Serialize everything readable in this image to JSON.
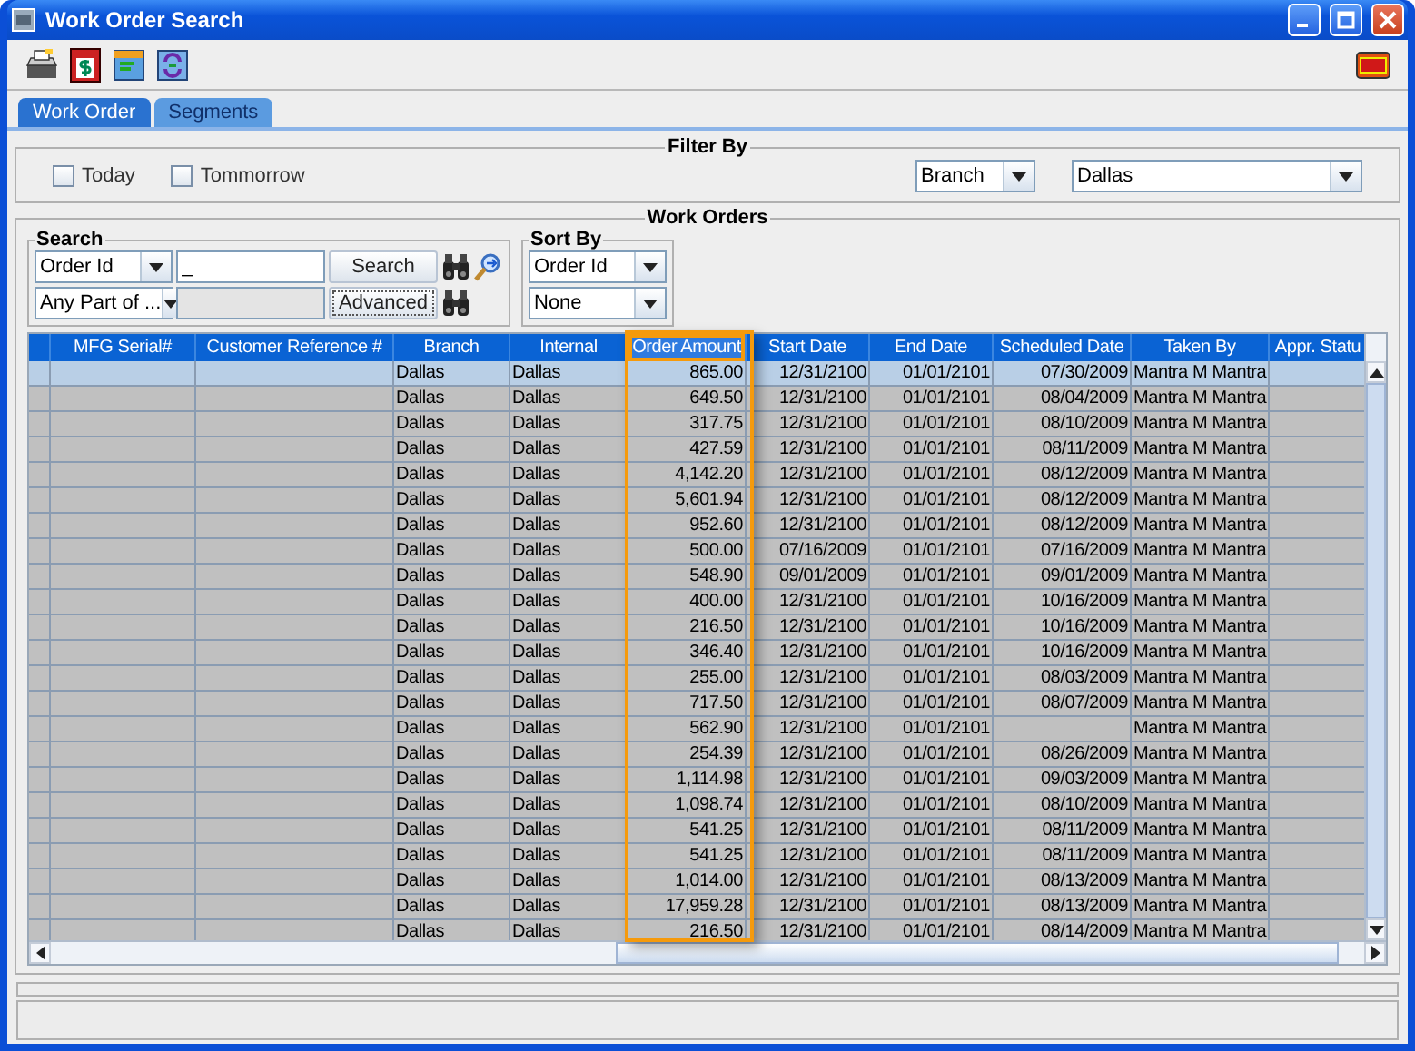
{
  "window": {
    "title": "Work Order Search"
  },
  "tabs": [
    {
      "label": "Work Order",
      "selected": true
    },
    {
      "label": "Segments",
      "selected": false
    }
  ],
  "filter": {
    "title": "Filter By",
    "today": {
      "label": "Today",
      "checked": false
    },
    "tomorrow": {
      "label": "Tommorrow",
      "checked": false
    },
    "field": "Branch",
    "value": "Dallas"
  },
  "work_orders": {
    "title": "Work Orders",
    "search": {
      "title": "Search",
      "field": "Order Id",
      "match": "Any Part of ...",
      "value": "_",
      "search_button": "Search",
      "advanced_button": "Advanced"
    },
    "sort": {
      "title": "Sort By",
      "field": "Order Id",
      "order": "None"
    },
    "table": {
      "columns": [
        {
          "label": "MFG Serial#",
          "highlighted": false
        },
        {
          "label": "Customer Reference #",
          "highlighted": false
        },
        {
          "label": "Branch",
          "highlighted": false
        },
        {
          "label": "Internal",
          "highlighted": false
        },
        {
          "label": "Order Amount",
          "highlighted": true
        },
        {
          "label": "Start Date",
          "highlighted": false
        },
        {
          "label": "End Date",
          "highlighted": false
        },
        {
          "label": "Scheduled Date",
          "highlighted": false
        },
        {
          "label": "Taken By",
          "highlighted": false
        },
        {
          "label": "Appr. Statu",
          "highlighted": false
        }
      ],
      "rows": [
        {
          "selected": true,
          "branch": "Dallas",
          "internal": "Dallas",
          "order_amount": "865.00",
          "start_date": "12/31/2100",
          "end_date": "01/01/2101",
          "scheduled_date": "07/30/2009",
          "taken_by": "Mantra M Mantra"
        },
        {
          "selected": false,
          "branch": "Dallas",
          "internal": "Dallas",
          "order_amount": "649.50",
          "start_date": "12/31/2100",
          "end_date": "01/01/2101",
          "scheduled_date": "08/04/2009",
          "taken_by": "Mantra M Mantra"
        },
        {
          "selected": false,
          "branch": "Dallas",
          "internal": "Dallas",
          "order_amount": "317.75",
          "start_date": "12/31/2100",
          "end_date": "01/01/2101",
          "scheduled_date": "08/10/2009",
          "taken_by": "Mantra M Mantra"
        },
        {
          "selected": false,
          "branch": "Dallas",
          "internal": "Dallas",
          "order_amount": "427.59",
          "start_date": "12/31/2100",
          "end_date": "01/01/2101",
          "scheduled_date": "08/11/2009",
          "taken_by": "Mantra M Mantra"
        },
        {
          "selected": false,
          "branch": "Dallas",
          "internal": "Dallas",
          "order_amount": "4,142.20",
          "start_date": "12/31/2100",
          "end_date": "01/01/2101",
          "scheduled_date": "08/12/2009",
          "taken_by": "Mantra M Mantra"
        },
        {
          "selected": false,
          "branch": "Dallas",
          "internal": "Dallas",
          "order_amount": "5,601.94",
          "start_date": "12/31/2100",
          "end_date": "01/01/2101",
          "scheduled_date": "08/12/2009",
          "taken_by": "Mantra M Mantra"
        },
        {
          "selected": false,
          "branch": "Dallas",
          "internal": "Dallas",
          "order_amount": "952.60",
          "start_date": "12/31/2100",
          "end_date": "01/01/2101",
          "scheduled_date": "08/12/2009",
          "taken_by": "Mantra M Mantra"
        },
        {
          "selected": false,
          "branch": "Dallas",
          "internal": "Dallas",
          "order_amount": "500.00",
          "start_date": "07/16/2009",
          "end_date": "01/01/2101",
          "scheduled_date": "07/16/2009",
          "taken_by": "Mantra M Mantra"
        },
        {
          "selected": false,
          "branch": "Dallas",
          "internal": "Dallas",
          "order_amount": "548.90",
          "start_date": "09/01/2009",
          "end_date": "01/01/2101",
          "scheduled_date": "09/01/2009",
          "taken_by": "Mantra M Mantra"
        },
        {
          "selected": false,
          "branch": "Dallas",
          "internal": "Dallas",
          "order_amount": "400.00",
          "start_date": "12/31/2100",
          "end_date": "01/01/2101",
          "scheduled_date": "10/16/2009",
          "taken_by": "Mantra M Mantra"
        },
        {
          "selected": false,
          "branch": "Dallas",
          "internal": "Dallas",
          "order_amount": "216.50",
          "start_date": "12/31/2100",
          "end_date": "01/01/2101",
          "scheduled_date": "10/16/2009",
          "taken_by": "Mantra M Mantra"
        },
        {
          "selected": false,
          "branch": "Dallas",
          "internal": "Dallas",
          "order_amount": "346.40",
          "start_date": "12/31/2100",
          "end_date": "01/01/2101",
          "scheduled_date": "10/16/2009",
          "taken_by": "Mantra M Mantra"
        },
        {
          "selected": false,
          "branch": "Dallas",
          "internal": "Dallas",
          "order_amount": "255.00",
          "start_date": "12/31/2100",
          "end_date": "01/01/2101",
          "scheduled_date": "08/03/2009",
          "taken_by": "Mantra M Mantra"
        },
        {
          "selected": false,
          "branch": "Dallas",
          "internal": "Dallas",
          "order_amount": "717.50",
          "start_date": "12/31/2100",
          "end_date": "01/01/2101",
          "scheduled_date": "08/07/2009",
          "taken_by": "Mantra M Mantra"
        },
        {
          "selected": false,
          "branch": "Dallas",
          "internal": "Dallas",
          "order_amount": "562.90",
          "start_date": "12/31/2100",
          "end_date": "01/01/2101",
          "taken_by": "Mantra M Mantra"
        },
        {
          "selected": false,
          "branch": "Dallas",
          "internal": "Dallas",
          "order_amount": "254.39",
          "start_date": "12/31/2100",
          "end_date": "01/01/2101",
          "scheduled_date": "08/26/2009",
          "taken_by": "Mantra M Mantra"
        },
        {
          "selected": false,
          "branch": "Dallas",
          "internal": "Dallas",
          "order_amount": "1,114.98",
          "start_date": "12/31/2100",
          "end_date": "01/01/2101",
          "scheduled_date": "09/03/2009",
          "taken_by": "Mantra M Mantra"
        },
        {
          "selected": false,
          "branch": "Dallas",
          "internal": "Dallas",
          "order_amount": "1,098.74",
          "start_date": "12/31/2100",
          "end_date": "01/01/2101",
          "scheduled_date": "08/10/2009",
          "taken_by": "Mantra M Mantra"
        },
        {
          "selected": false,
          "branch": "Dallas",
          "internal": "Dallas",
          "order_amount": "541.25",
          "start_date": "12/31/2100",
          "end_date": "01/01/2101",
          "scheduled_date": "08/11/2009",
          "taken_by": "Mantra M Mantra"
        },
        {
          "selected": false,
          "branch": "Dallas",
          "internal": "Dallas",
          "order_amount": "541.25",
          "start_date": "12/31/2100",
          "end_date": "01/01/2101",
          "scheduled_date": "08/11/2009",
          "taken_by": "Mantra M Mantra"
        },
        {
          "selected": false,
          "branch": "Dallas",
          "internal": "Dallas",
          "order_amount": "1,014.00",
          "start_date": "12/31/2100",
          "end_date": "01/01/2101",
          "scheduled_date": "08/13/2009",
          "taken_by": "Mantra M Mantra"
        },
        {
          "selected": false,
          "branch": "Dallas",
          "internal": "Dallas",
          "order_amount": "17,959.28",
          "start_date": "12/31/2100",
          "end_date": "01/01/2101",
          "scheduled_date": "08/13/2009",
          "taken_by": "Mantra M Mantra"
        },
        {
          "selected": false,
          "branch": "Dallas",
          "internal": "Dallas",
          "order_amount": "216.50",
          "start_date": "12/31/2100",
          "end_date": "01/01/2101",
          "scheduled_date": "08/14/2009",
          "taken_by": "Mantra M Mantra"
        }
      ]
    }
  }
}
